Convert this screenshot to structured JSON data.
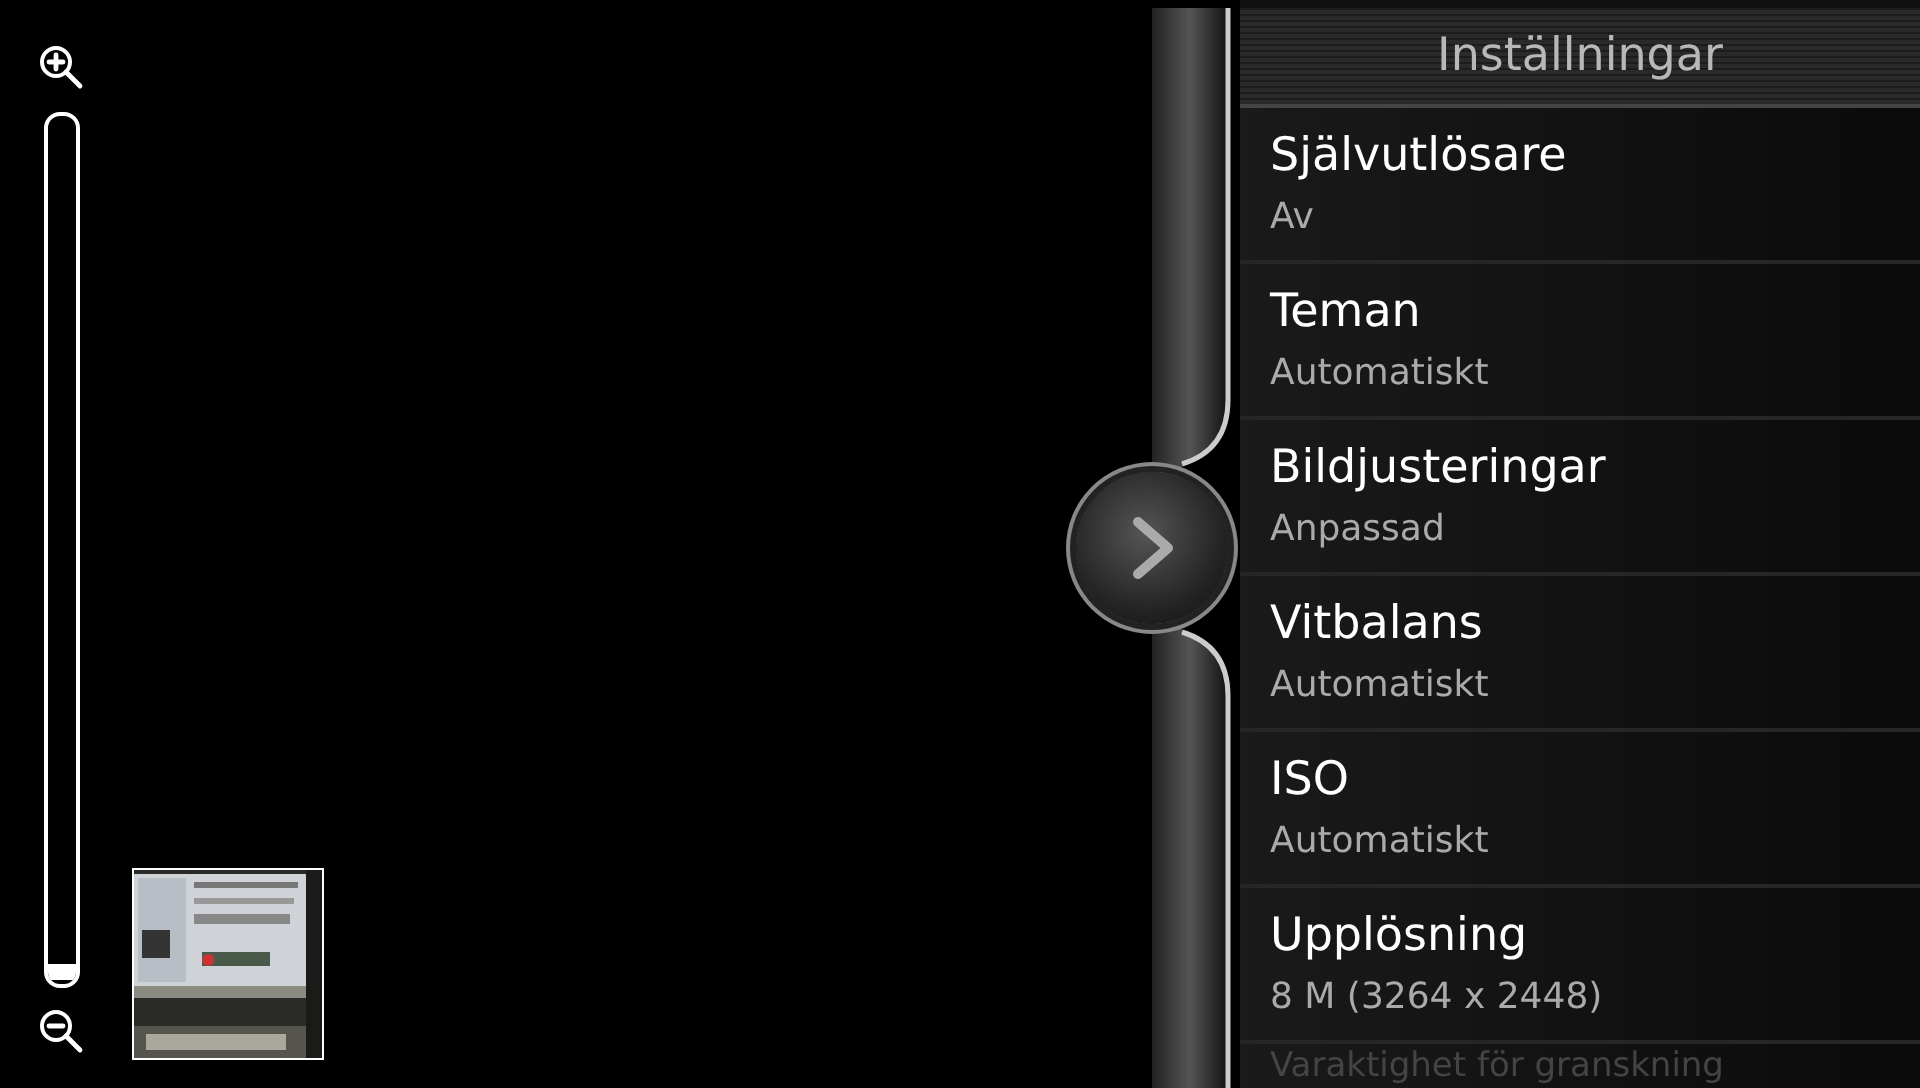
{
  "zoom": {
    "level": 0
  },
  "panel": {
    "title": "Inställningar",
    "items": [
      {
        "title": "Självutlösare",
        "value": "Av"
      },
      {
        "title": "Teman",
        "value": "Automatiskt"
      },
      {
        "title": "Bildjusteringar",
        "value": "Anpassad"
      },
      {
        "title": "Vitbalans",
        "value": "Automatiskt"
      },
      {
        "title": "ISO",
        "value": "Automatiskt"
      },
      {
        "title": "Upplösning",
        "value": "8 M (3264 x 2448)"
      },
      {
        "title": "Varaktighet för granskning"
      }
    ]
  }
}
